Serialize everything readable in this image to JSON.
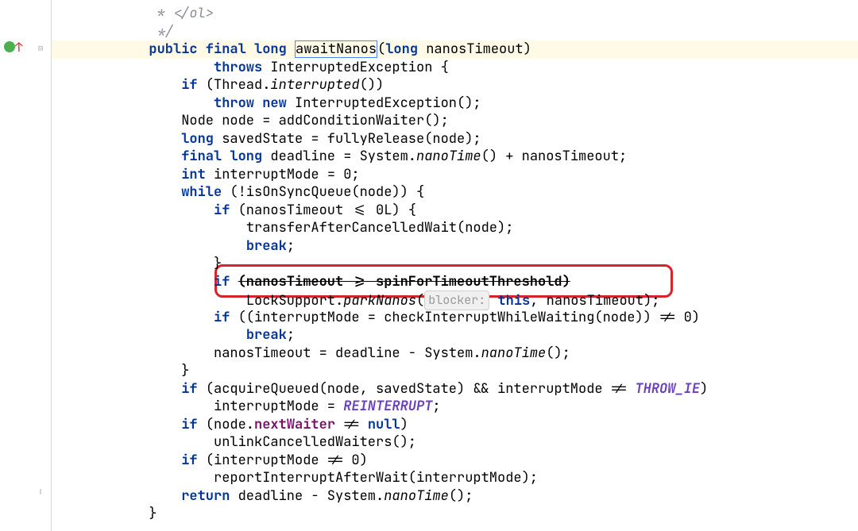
{
  "comment_tail": " * </ol>",
  "comment_end": " */",
  "sig_before": "public final long ",
  "sig_method": "awaitNanos",
  "sig_after1": "(",
  "sig_param_kw": "long ",
  "sig_param_name": "nanosTimeout)",
  "throws_kw": "throws ",
  "throws_rest": "InterruptedException {",
  "l_if1_kw": "if ",
  "l_if1_a": "(Thread.",
  "l_if1_ital": "interrupted",
  "l_if1_b": "())",
  "l_throw_kw": "throw new ",
  "l_throw_rest": "InterruptedException();",
  "l_node": "Node node = addConditionWaiter();",
  "l_long_kw": "long ",
  "l_saved": "savedState = fullyRelease(node);",
  "l_final_kw": "final long ",
  "l_dead_a": "deadline = System.",
  "l_nano_ital": "nanoTime",
  "l_dead_b": "() + nanosTimeout;",
  "l_int_kw": "int ",
  "l_int_rest": "interruptMode = 0;",
  "l_while_kw": "while ",
  "l_while_rest": "(!isOnSyncQueue(node)) {",
  "l_if2_kw": "if ",
  "l_if2_rest": "(nanosTimeout <= 0L) {",
  "l_xfer": "transferAfterCancelledWait(node);",
  "l_break_kw": "break",
  "l_semi": ";",
  "l_close": "}",
  "l_if3_kw": "if ",
  "l_if3_strike": "(nanosTimeout >= spinForTimeoutThreshold)",
  "l_lock_a": "LockSupport.",
  "l_parkNanos": "parkNanos",
  "l_lock_b": "(",
  "hint_label": "blocker:",
  "l_lock_c": " ",
  "l_this_kw": "this",
  "l_lock_d": ", nanosTimeout);",
  "l_if4_kw": "if ",
  "l_if4_rest": "((interruptMode = checkInterruptWhileWaiting(node)) != 0)",
  "l_nassign_a": "nanosTimeout = deadline - System.",
  "l_nassign_b": "();",
  "l_if5_kw": "if ",
  "l_if5_a": "(acquireQueued(node, savedState) && interruptMode != ",
  "l_THROW_IE": "THROW_IE",
  "l_if5_b": ")",
  "l_rein_a": "interruptMode = ",
  "l_REINTERRUPT": "REINTERRUPT",
  "l_if6_kw": "if ",
  "l_if6_a": "(node.",
  "l_nextWaiter": "nextWaiter",
  "l_if6_b": " != ",
  "l_null_kw": "null",
  "l_if6_c": ")",
  "l_unlink": "unlinkCancelledWaiters();",
  "l_if7_kw": "if ",
  "l_if7_rest": "(interruptMode != 0)",
  "l_report": "reportInterruptAfterWait(interruptMode);",
  "l_ret_kw": "return ",
  "l_ret_a": "deadline - System.",
  "l_ret_b": "();"
}
